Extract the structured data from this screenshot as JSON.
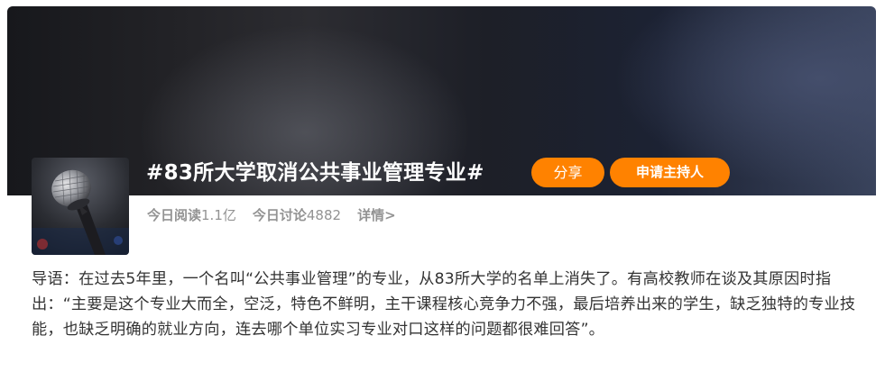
{
  "topic": {
    "title": "#83所大学取消公共事业管理专业#",
    "share_label": "分享",
    "apply_host_label": "申请主持人"
  },
  "stats": {
    "read_label": "今日阅读",
    "read_value": "1.1亿",
    "discuss_label": "今日讨论",
    "discuss_value": "4882",
    "detail_label": "详情>"
  },
  "intro": {
    "text": "导语：在过去5年里，一个名叫“公共事业管理”的专业，从83所大学的名单上消失了。有高校教师在谈及其原因时指出：“主要是这个专业大而全，空泛，特色不鲜明，主干课程核心竞争力不强，最后培养出来的学生，缺乏独特的专业技能，也缺乏明确的就业方向，连去哪个单位实习专业对口这样的问题都很难回答”。"
  },
  "colors": {
    "accent": "#ff8200",
    "stats_text": "#939393",
    "body_text": "#333333"
  },
  "icons": {
    "thumbnail": "microphone-image"
  }
}
